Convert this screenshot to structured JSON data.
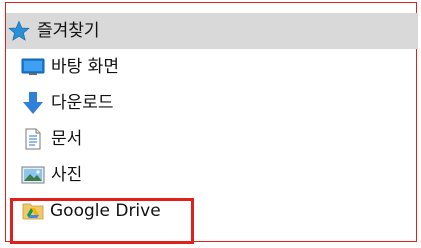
{
  "nav_pane": {
    "items": [
      {
        "label": "즐겨찾기",
        "icon": "star-icon",
        "selected": true
      },
      {
        "label": "바탕 화면",
        "icon": "desktop-icon",
        "selected": false
      },
      {
        "label": "다운로드",
        "icon": "download-arrow-icon",
        "selected": false
      },
      {
        "label": "문서",
        "icon": "document-icon",
        "selected": false
      },
      {
        "label": "사진",
        "icon": "pictures-icon",
        "selected": false
      },
      {
        "label": "Google Drive",
        "icon": "google-drive-folder-icon",
        "selected": false
      }
    ]
  },
  "colors": {
    "selection_background": "#d9d9d9",
    "highlight_outline": "#e0201a",
    "star": "#2b8fd6",
    "download_arrow": "#2f7fdb",
    "desktop": "#1a7bd6"
  }
}
